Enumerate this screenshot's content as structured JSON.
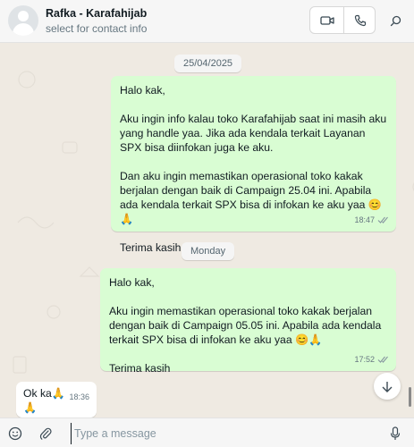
{
  "header": {
    "contact_name": "Rafka - Karafahijab",
    "subtitle": "select for contact info",
    "icons": [
      "video-call-icon",
      "phone-call-icon",
      "search-icon"
    ]
  },
  "chat": {
    "date_chip_1": "25/04/2025",
    "message_1": {
      "text": "Halo kak,\n\nAku ingin info kalau toko Karafahijab saat ini masih aku yang handle yaa. Jika ada kendala terkait Layanan SPX bisa diinfokan juga ke aku.\n\nDan aku ingin memastikan operasional toko kakak berjalan dengan baik di Campaign 25.04 ini. Apabila ada kendala terkait SPX bisa di infokan ke aku yaa 😊🙏\n\nTerima kasih",
      "time": "18:47"
    },
    "date_chip_2": "Monday",
    "message_2": {
      "text": "Halo kak,\n\nAku ingin memastikan operasional toko kakak berjalan dengan baik di Campaign 05.05 ini. Apabila ada kendala terkait SPX bisa di infokan ke aku yaa 😊🙏\n\nTerima kasih",
      "time": "17:52"
    },
    "message_3": {
      "text": "Ok ka🙏\n🙏",
      "time": "18:36"
    }
  },
  "footer": {
    "placeholder": "Type a message",
    "value": "",
    "icons": [
      "emoji-icon",
      "attach-icon",
      "mic-icon"
    ]
  },
  "colors": {
    "outgoing_bubble": "#d9fdd3",
    "incoming_bubble": "#ffffff",
    "chat_background": "#efeae2",
    "read_ticks": "#8696a0"
  }
}
